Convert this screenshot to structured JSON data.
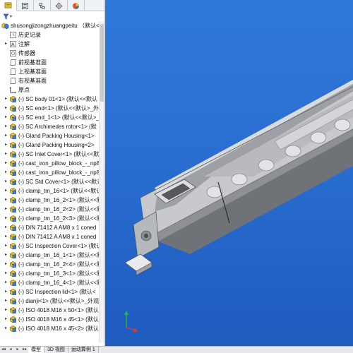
{
  "tree": {
    "root_label": "shusongjizongzhuangpeitu （默认<<默认",
    "items": [
      {
        "label": "历史记录",
        "icon": "history-icon",
        "expandable": false
      },
      {
        "label": "注解",
        "icon": "annotation-icon",
        "expandable": true
      },
      {
        "label": "传感器",
        "icon": "sensor-icon",
        "expandable": false
      },
      {
        "label": "前视基准面",
        "icon": "plane-icon",
        "expandable": false
      },
      {
        "label": "上视基准面",
        "icon": "plane-icon",
        "expandable": false
      },
      {
        "label": "右视基准面",
        "icon": "plane-icon",
        "expandable": false
      },
      {
        "label": "原点",
        "icon": "origin-icon",
        "expandable": false
      },
      {
        "label": "(-) SC body 01<1> (默认<<默认",
        "icon": "part-icon",
        "expandable": true
      },
      {
        "label": "(-) SC end<1> (默认<<默认>_外",
        "icon": "part-icon",
        "expandable": true
      },
      {
        "label": "(-) SC end_1<1> (默认<<默认>_",
        "icon": "part-icon",
        "expandable": true
      },
      {
        "label": "(-) SC Archimedes rotor<1> (默",
        "icon": "part-icon",
        "expandable": true
      },
      {
        "label": "(-) Gland Packing Housing<1>",
        "icon": "part-icon",
        "expandable": true
      },
      {
        "label": "(-) Gland Packing Housing<2>",
        "icon": "part-icon",
        "expandable": true
      },
      {
        "label": "(-) SC Inlet Cover<1> (默认<<默",
        "icon": "part-icon",
        "expandable": true
      },
      {
        "label": "(-) cast_iron_pillow_block_-_np8",
        "icon": "part-icon",
        "expandable": true
      },
      {
        "label": "(-) cast_iron_pillow_block_-_np8",
        "icon": "part-icon",
        "expandable": true
      },
      {
        "label": "(-) SC Std Cover<1> (默认<<默认",
        "icon": "part-icon",
        "expandable": true
      },
      {
        "label": "(-) clamp_tm_16<1> (默认<<默认",
        "icon": "part-icon",
        "expandable": true
      },
      {
        "label": "(-) clamp_tm_16_2<1> (默认<<默",
        "icon": "part-icon",
        "expandable": true
      },
      {
        "label": "(-) clamp_tm_16_2<2> (默认<<默",
        "icon": "part-icon",
        "expandable": true
      },
      {
        "label": "(-) clamp_tm_16_2<3> (默认<<默",
        "icon": "part-icon",
        "expandable": true
      },
      {
        "label": "(-) DIN 71412 A AM8 x 1 coned",
        "icon": "part-icon",
        "expandable": true
      },
      {
        "label": "(-) DIN 71412 A AM8 x 1 coned",
        "icon": "part-icon",
        "expandable": true
      },
      {
        "label": "(-) SC Inspection Cover<1> (默认",
        "icon": "part-icon",
        "expandable": true
      },
      {
        "label": "(-) clamp_tm_16_1<1> (默认<<默",
        "icon": "part-icon",
        "expandable": true
      },
      {
        "label": "(-) clamp_tm_16_2<4> (默认<<默",
        "icon": "part-icon",
        "expandable": true
      },
      {
        "label": "(-) clamp_tm_16_3<1> (默认<<默",
        "icon": "part-icon",
        "expandable": true
      },
      {
        "label": "(-) clamp_tm_16_4<1> (默认<<默",
        "icon": "part-icon",
        "expandable": true
      },
      {
        "label": "(-) SC Inspection lid<1> (默认<",
        "icon": "part-icon",
        "expandable": true
      },
      {
        "label": "(-) dianji<1> (默认<<默认>_外观",
        "icon": "part-icon",
        "expandable": true
      },
      {
        "label": "(-) ISO 4018 M16 x 50<1> (默认",
        "icon": "part-icon",
        "expandable": true
      },
      {
        "label": "(-) ISO 4018 M16 x 45<1> (默认",
        "icon": "part-icon",
        "expandable": true
      },
      {
        "label": "(-) ISO 4018 M16 x 45<2> (默认",
        "icon": "part-icon",
        "expandable": true
      }
    ]
  },
  "bottom_tabs": [
    {
      "label": "模型",
      "active": true
    },
    {
      "label": "3D 视图",
      "active": false
    },
    {
      "label": "运动算例 1",
      "active": false
    }
  ],
  "colors": {
    "viewport_top": "#2f78d8",
    "viewport_bottom": "#1d5bbd",
    "part_icon": "#e7c23a"
  }
}
